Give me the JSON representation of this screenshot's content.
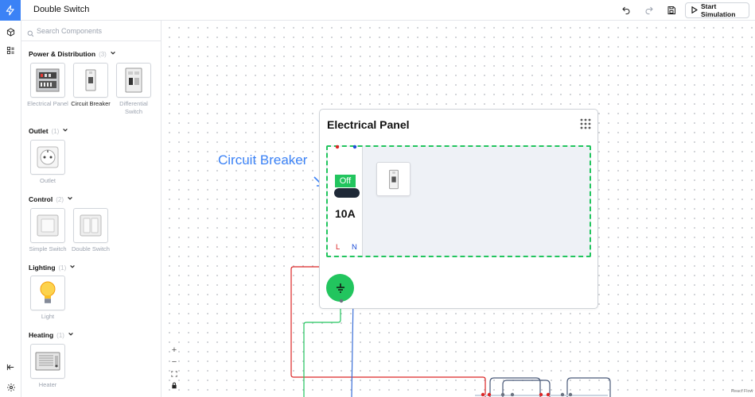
{
  "app": {
    "title": "Double Switch",
    "start_label": "Start Simulation",
    "icons": [
      "logo-bolt-icon",
      "undo-icon",
      "redo-icon",
      "save-icon",
      "play-icon"
    ]
  },
  "rail": {
    "icons": [
      "components-cube-icon",
      "layers-list-icon",
      "collapse-sidebar-icon",
      "settings-gear-icon"
    ]
  },
  "search": {
    "placeholder": "Search Components"
  },
  "categories": [
    {
      "name": "Power & Distribution",
      "count": "(3)",
      "items": [
        {
          "label": "Electrical Panel"
        },
        {
          "label": "Circuit Breaker"
        },
        {
          "label": "Differential Switch"
        }
      ]
    },
    {
      "name": "Outlet",
      "count": "(1)",
      "items": [
        {
          "label": "Outlet"
        }
      ]
    },
    {
      "name": "Control",
      "count": "(2)",
      "items": [
        {
          "label": "Simple Switch"
        },
        {
          "label": "Double Switch"
        }
      ]
    },
    {
      "name": "Lighting",
      "count": "(1)",
      "items": [
        {
          "label": "Light"
        }
      ]
    },
    {
      "name": "Heating",
      "count": "(1)",
      "items": [
        {
          "label": "Heater"
        }
      ]
    }
  ],
  "canvas": {
    "panel_title": "Electrical Panel",
    "breaker": {
      "state": "Off",
      "rating": "10A",
      "terminal_l": "L",
      "terminal_n": "N"
    },
    "annotation": "Circuit Breaker",
    "attribution": "React Flow",
    "colors": {
      "accent": "#3b82f6",
      "green": "#22c55e",
      "live": "#dc2626",
      "neutral": "#1d4ed8"
    }
  }
}
